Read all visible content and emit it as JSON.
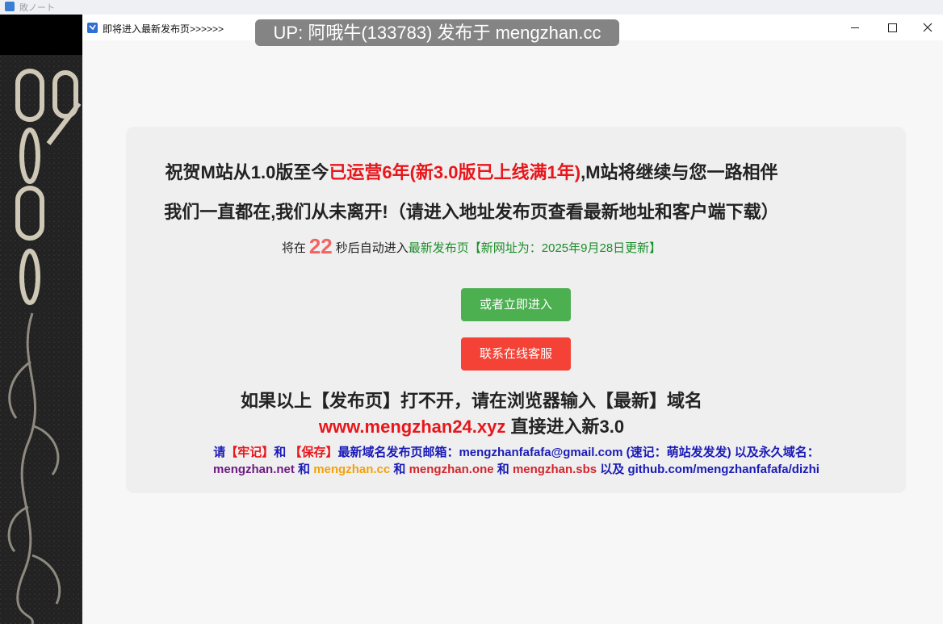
{
  "background_window": {
    "title": "敗ノート"
  },
  "window": {
    "title": "即将进入最新发布页>>>>>>",
    "controls": {
      "minimize": "minimize-icon",
      "maximize": "maximize-icon",
      "close": "close-icon"
    }
  },
  "overlay": {
    "up_badge": "UP: 阿哦牛(133783) 发布于 mengzhan.cc"
  },
  "content": {
    "headline_prefix": "祝贺M站从1.0版至今",
    "headline_highlight": "已运营6年(新3.0版已上线满1年)",
    "headline_suffix": ",M站将继续与您一路相伴",
    "subheadline": "我们一直都在,我们从未离开!（请进入地址发布页查看最新地址和客户端下载）",
    "countdown_prefix": "将在",
    "countdown_seconds": "22",
    "countdown_middle": "秒后自动进入",
    "countdown_link": "最新发布页【新网址为：2025年9月28日更新】",
    "enter_now_button": "或者立即进入",
    "support_button": "联系在线客服",
    "fallback_line": "如果以上【发布页】打不开，请在浏览器输入【最新】域名",
    "fallback_domain": "www.mengzhan24.xyz",
    "fallback_suffix": " 直接进入新3.0",
    "note_please": "请",
    "note_remember": "【牢记】",
    "note_and": "和",
    "note_save": "【保存】",
    "note_text": "最新域名发布页邮箱：mengzhanfafafa@gmail.com (速记：萌站发发发) 以及永久域名：",
    "domains": {
      "d1": "mengzhan.net",
      "sep1": " 和 ",
      "d2": "mengzhan.cc",
      "sep2": " 和 ",
      "d3": "mengzhan.one",
      "sep3": " 和 ",
      "d4": "mengzhan.sbs",
      "sep4": " 以及 ",
      "d5": "github.com/mengzhanfafafa/dizhi"
    }
  },
  "colors": {
    "green_button": "#4caf50",
    "red_button": "#f44336",
    "highlight_red": "#e8161b",
    "countdown": "#f06464",
    "link_green": "#1c8e2a",
    "note_blue": "#1a1ab8"
  }
}
